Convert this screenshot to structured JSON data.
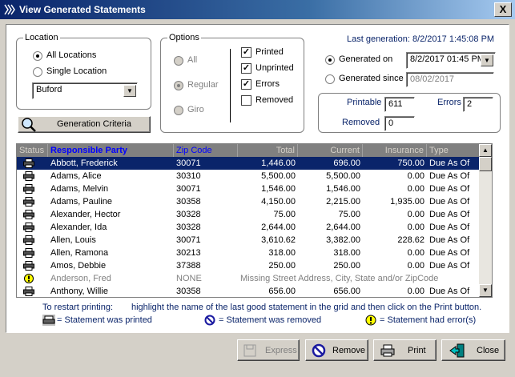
{
  "window": {
    "title": "View Generated Statements",
    "close_glyph": "X"
  },
  "location": {
    "title": "Location",
    "all_label": "All Locations",
    "single_label": "Single Location",
    "selected": "Buford"
  },
  "options": {
    "title": "Options",
    "all_label": "All",
    "regular_label": "Regular",
    "giro_label": "Giro",
    "printed_label": "Printed",
    "unprinted_label": "Unprinted",
    "errors_label": "Errors",
    "removed_label": "Removed",
    "printed_checked": "✓",
    "unprinted_checked": "✓",
    "errors_checked": "✓"
  },
  "generation": {
    "last_generation": "Last generation: 8/2/2017 1:45:08 PM",
    "generated_on_label": "Generated on",
    "generated_on_value": "8/2/2017 01:45 PM",
    "generated_since_label": "Generated since",
    "generated_since_value": "08/02/2017"
  },
  "counts": {
    "printable_label": "Printable",
    "printable_value": "611",
    "errors_label": "Errors",
    "errors_value": "2",
    "removed_label": "Removed",
    "removed_value": "0"
  },
  "criteria_button": "Generation Criteria",
  "grid": {
    "headers": {
      "status": "Status",
      "party": "Responsible Party",
      "zip": "Zip Code",
      "total": "Total",
      "current": "Current",
      "insurance": "Insurance",
      "type": "Type"
    },
    "rows": [
      {
        "name": "Abbott, Frederick",
        "zip": "30071",
        "total": "1,446.00",
        "current": "696.00",
        "insurance": "750.00",
        "type": "Due As Of"
      },
      {
        "name": "Adams, Alice",
        "zip": "30310",
        "total": "5,500.00",
        "current": "5,500.00",
        "insurance": "0.00",
        "type": "Due As Of"
      },
      {
        "name": "Adams, Melvin",
        "zip": "30071",
        "total": "1,546.00",
        "current": "1,546.00",
        "insurance": "0.00",
        "type": "Due As Of"
      },
      {
        "name": "Adams, Pauline",
        "zip": "30358",
        "total": "4,150.00",
        "current": "2,215.00",
        "insurance": "1,935.00",
        "type": "Due As Of"
      },
      {
        "name": "Alexander, Hector",
        "zip": "30328",
        "total": "75.00",
        "current": "75.00",
        "insurance": "0.00",
        "type": "Due As Of"
      },
      {
        "name": "Alexander, Ida",
        "zip": "30328",
        "total": "2,644.00",
        "current": "2,644.00",
        "insurance": "0.00",
        "type": "Due As Of"
      },
      {
        "name": "Allen, Louis",
        "zip": "30071",
        "total": "3,610.62",
        "current": "3,382.00",
        "insurance": "228.62",
        "type": "Due As Of"
      },
      {
        "name": "Allen, Ramona",
        "zip": "30213",
        "total": "318.00",
        "current": "318.00",
        "insurance": "0.00",
        "type": "Due As Of"
      },
      {
        "name": "Amos, Debbie",
        "zip": "37388",
        "total": "250.00",
        "current": "250.00",
        "insurance": "0.00",
        "type": "Due As Of"
      },
      {
        "name": "Anderson, Fred",
        "zip": "NONE",
        "error": "Missing Street Address, City, State and/or ZipCode"
      },
      {
        "name": "Anthony, Willie",
        "zip": "30358",
        "total": "656.00",
        "current": "656.00",
        "insurance": "0.00",
        "type": "Due As Of"
      }
    ]
  },
  "legend": {
    "restart_label": "To restart printing:",
    "restart_text": "highlight the name of the last good statement in the grid and then click on the Print button.",
    "printed": "= Statement was printed",
    "removed": "= Statement was removed",
    "error": "= Statement had error(s)"
  },
  "buttons": {
    "express": "Express",
    "remove": "Remove",
    "print": "Print",
    "close": "Close"
  },
  "colors": {
    "title_bar": "#0a246a",
    "selection": "#0a246a",
    "header_text_blue": "#0000ff",
    "error_icon": "#ffff00"
  }
}
